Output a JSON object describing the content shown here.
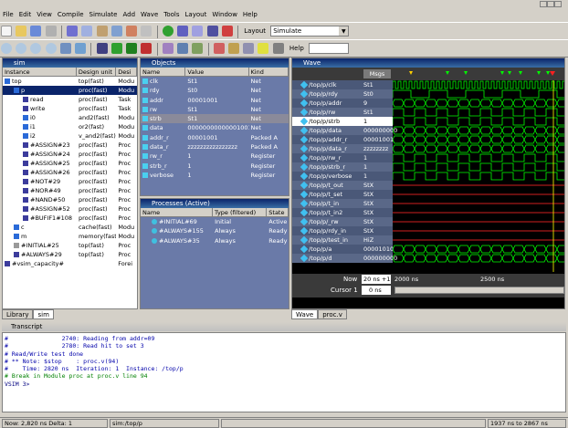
{
  "menu": [
    "File",
    "Edit",
    "View",
    "Compile",
    "Simulate",
    "Add",
    "Wave",
    "Tools",
    "Layout",
    "Window",
    "Help"
  ],
  "toolbar": {
    "layout_label": "Layout",
    "layout_value": "Simulate",
    "help_label": "Help"
  },
  "sim": {
    "title": "sim",
    "cols": [
      "Instance",
      "Design unit",
      "Desi"
    ],
    "rows": [
      {
        "indent": 0,
        "name": "top",
        "unit": "top(fast)",
        "type": "Modu",
        "color": "#2a6ad8",
        "sel": false
      },
      {
        "indent": 1,
        "name": "p",
        "unit": "proc(fast)",
        "type": "Modu",
        "color": "#2a6ad8",
        "sel": true
      },
      {
        "indent": 2,
        "name": "read",
        "unit": "proc(fast)",
        "type": "Task",
        "color": "#3c3c9c",
        "sel": false
      },
      {
        "indent": 2,
        "name": "write",
        "unit": "proc(fast)",
        "type": "Task",
        "color": "#3c3c9c",
        "sel": false
      },
      {
        "indent": 2,
        "name": "i0",
        "unit": "and2(fast)",
        "type": "Modu",
        "color": "#2a6ad8",
        "sel": false
      },
      {
        "indent": 2,
        "name": "i1",
        "unit": "or2(fast)",
        "type": "Modu",
        "color": "#2a6ad8",
        "sel": false
      },
      {
        "indent": 2,
        "name": "i2",
        "unit": "v_and2(fast)",
        "type": "Modu",
        "color": "#2a6ad8",
        "sel": false
      },
      {
        "indent": 2,
        "name": "#ASSIGN#23",
        "unit": "proc(fast)",
        "type": "Proc",
        "color": "#3c3c9c",
        "sel": false
      },
      {
        "indent": 2,
        "name": "#ASSIGN#24",
        "unit": "proc(fast)",
        "type": "Proc",
        "color": "#3c3c9c",
        "sel": false
      },
      {
        "indent": 2,
        "name": "#ASSIGN#25",
        "unit": "proc(fast)",
        "type": "Proc",
        "color": "#3c3c9c",
        "sel": false
      },
      {
        "indent": 2,
        "name": "#ASSIGN#26",
        "unit": "proc(fast)",
        "type": "Proc",
        "color": "#3c3c9c",
        "sel": false
      },
      {
        "indent": 2,
        "name": "#NOT#29",
        "unit": "proc(fast)",
        "type": "Proc",
        "color": "#3c3c9c",
        "sel": false
      },
      {
        "indent": 2,
        "name": "#NOR#49",
        "unit": "proc(fast)",
        "type": "Proc",
        "color": "#3c3c9c",
        "sel": false
      },
      {
        "indent": 2,
        "name": "#NAND#50",
        "unit": "proc(fast)",
        "type": "Proc",
        "color": "#3c3c9c",
        "sel": false
      },
      {
        "indent": 2,
        "name": "#ASSIGN#52",
        "unit": "proc(fast)",
        "type": "Proc",
        "color": "#3c3c9c",
        "sel": false
      },
      {
        "indent": 2,
        "name": "#BUFIF1#108",
        "unit": "proc(fast)",
        "type": "Proc",
        "color": "#3c3c9c",
        "sel": false
      },
      {
        "indent": 1,
        "name": "c",
        "unit": "cache(fast)",
        "type": "Modu",
        "color": "#2a6ad8",
        "sel": false
      },
      {
        "indent": 1,
        "name": "m",
        "unit": "memory(fast)",
        "type": "Modu",
        "color": "#2a6ad8",
        "sel": false
      },
      {
        "indent": 1,
        "name": "#INITIAL#25",
        "unit": "top(fast)",
        "type": "Proc",
        "color": "#9a9a9a",
        "sel": false
      },
      {
        "indent": 1,
        "name": "#ALWAYS#29",
        "unit": "top(fast)",
        "type": "Proc",
        "color": "#3c3c9c",
        "sel": false
      },
      {
        "indent": 0,
        "name": "#vsim_capacity#",
        "unit": "",
        "type": "Forei",
        "color": "#3c3c9c",
        "sel": false
      }
    ],
    "tabs": [
      "Library",
      "sim"
    ]
  },
  "objects": {
    "title": "Objects",
    "cols": [
      "Name",
      "Value",
      "Kind"
    ],
    "rows": [
      {
        "name": "clk",
        "value": "St1",
        "kind": "Net",
        "sel": false
      },
      {
        "name": "rdy",
        "value": "St0",
        "kind": "Net",
        "sel": false
      },
      {
        "name": "addr",
        "value": "00001001",
        "kind": "Net",
        "sel": false
      },
      {
        "name": "rw",
        "value": "St1",
        "kind": "Net",
        "sel": false
      },
      {
        "name": "strb",
        "value": "St1",
        "kind": "Net",
        "sel": true
      },
      {
        "name": "data",
        "value": "00000000000001001",
        "kind": "Net",
        "sel": false
      },
      {
        "name": "addr_r",
        "value": "00001001",
        "kind": "Packed A",
        "sel": false
      },
      {
        "name": "data_r",
        "value": "zzzzzzzzzzzzzzzz",
        "kind": "Packed A",
        "sel": false
      },
      {
        "name": "rw_r",
        "value": "1",
        "kind": "Register",
        "sel": false
      },
      {
        "name": "strb_r",
        "value": "1",
        "kind": "Register",
        "sel": false
      },
      {
        "name": "verbose",
        "value": "1",
        "kind": "Register",
        "sel": false
      }
    ]
  },
  "processes": {
    "title": "Processes (Active)",
    "cols": [
      "Name",
      "Type (filtered)",
      "State"
    ],
    "rows": [
      {
        "name": "#INITIAL#69",
        "type": "Initial",
        "state": "Active"
      },
      {
        "name": "#ALWAYS#155",
        "type": "Always",
        "state": "Ready"
      },
      {
        "name": "#ALWAYS#35",
        "type": "Always",
        "state": "Ready"
      }
    ]
  },
  "wave": {
    "title": "Wave",
    "msgs_label": "Msgs",
    "signals": [
      {
        "name": "/top/p/clk",
        "value": "St1",
        "bus": false
      },
      {
        "name": "/top/p/rdy",
        "value": "St0",
        "bus": false
      },
      {
        "name": "/top/p/addr",
        "value": "9",
        "bus": true
      },
      {
        "name": "/top/p/rw",
        "value": "St1",
        "bus": false
      },
      {
        "name": "/top/p/strb",
        "value": "1",
        "bus": false
      },
      {
        "name": "/top/p/data",
        "value": "000000000",
        "bus": true
      },
      {
        "name": "/top/p/addr_r",
        "value": "00001001",
        "bus": true
      },
      {
        "name": "/top/p/data_r",
        "value": "zzzzzzzz",
        "bus": true
      },
      {
        "name": "/top/p/rw_r",
        "value": "1",
        "bus": false
      },
      {
        "name": "/top/p/strb_r",
        "value": "1",
        "bus": false
      },
      {
        "name": "/top/p/verbose",
        "value": "1",
        "bus": false
      },
      {
        "name": "/top/p/t_out",
        "value": "StX",
        "bus": false
      },
      {
        "name": "/top/p/t_set",
        "value": "StX",
        "bus": false
      },
      {
        "name": "/top/p/t_in",
        "value": "StX",
        "bus": false
      },
      {
        "name": "/top/p/t_in2",
        "value": "StX",
        "bus": false
      },
      {
        "name": "/top/p/_rw",
        "value": "StX",
        "bus": false
      },
      {
        "name": "/top/p/rdy_in",
        "value": "StX",
        "bus": false
      },
      {
        "name": "/top/p/test_in",
        "value": "HiZ",
        "bus": false
      },
      {
        "name": "/top/p/a",
        "value": "00001010",
        "bus": true
      },
      {
        "name": "/top/p/d",
        "value": "000000000",
        "bus": true
      }
    ],
    "now_label": "Now",
    "now_value": "20 ns +1",
    "cursor_label": "Cursor 1",
    "cursor_value": "0 ns",
    "time_labels": [
      "2000 ns",
      "2500 ns"
    ],
    "tabs": [
      "Wave",
      "proc.v"
    ]
  },
  "transcript": {
    "title": "Transcript",
    "lines": [
      "#               2740: Reading from addr=09",
      "#               2780: Read hit to set 3",
      "# Read/Write test done",
      "# ** Note: $stop    : proc.v(94)",
      "#    Time: 2820 ns  Iteration: 1  Instance: /top/p",
      "# Break in Module proc at proc.v line 94",
      "",
      "VSIM 3>"
    ]
  },
  "status": {
    "now": "Now: 2,820 ns  Delta: 1",
    "context": "sim:/top/p",
    "range": "1937 ns to 2867 ns"
  },
  "colors": {
    "sel": "#0a246a",
    "objbg": "#6a7aa8",
    "wavebg": "#000000",
    "green": "#00ff00"
  }
}
